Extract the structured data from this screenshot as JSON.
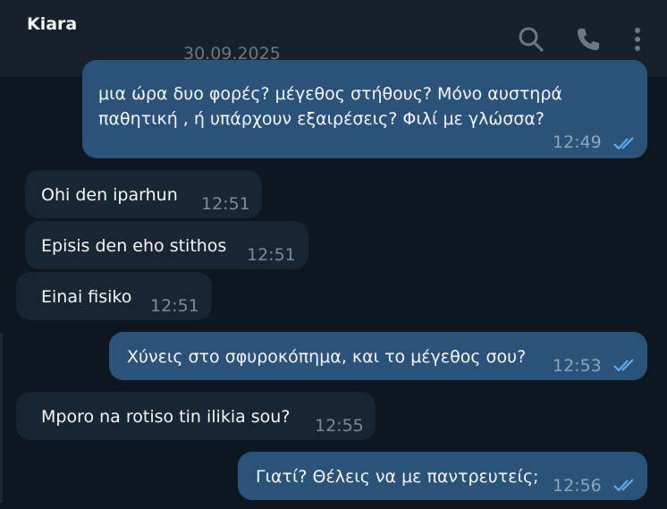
{
  "header": {
    "chat_name": "Kiara",
    "date": "30.09.2025",
    "icons": [
      "search-icon",
      "phone-icon",
      "more-vertical-icon"
    ]
  },
  "messages": [
    {
      "direction": "outgoing",
      "line1": "μια ώρα δυο φορές? μέγεθος στήθους? Μόνο αυστηρά",
      "line2": "παθητική , ή υπάρχουν εξαιρέσεις? Φιλί με γλώσσα?",
      "time": "12:49",
      "status": "read"
    },
    {
      "direction": "incoming",
      "text": "Ohi den iparhun",
      "time": "12:51"
    },
    {
      "direction": "incoming",
      "text": "Episis den eho stithos",
      "time": "12:51"
    },
    {
      "direction": "incoming",
      "text": "Einai fisiko",
      "time": "12:51"
    },
    {
      "direction": "outgoing",
      "text": "Χύνεις στο σφυροκόπημα, και το μέγεθος σου?",
      "time": "12:53",
      "status": "read"
    },
    {
      "direction": "incoming",
      "text": "Mporo na rotiso tin ilikia sou?",
      "time": "12:55"
    },
    {
      "direction": "outgoing",
      "text": "Γιατί? Θέλεις να με παντρευτείς;",
      "time": "12:56",
      "status": "read"
    }
  ],
  "colors": {
    "background": "#0e1621",
    "header": "#17212b",
    "incoming_bubble": "#182533",
    "outgoing_bubble": "#2b5278",
    "read_ticks": "#5fb2f2"
  }
}
